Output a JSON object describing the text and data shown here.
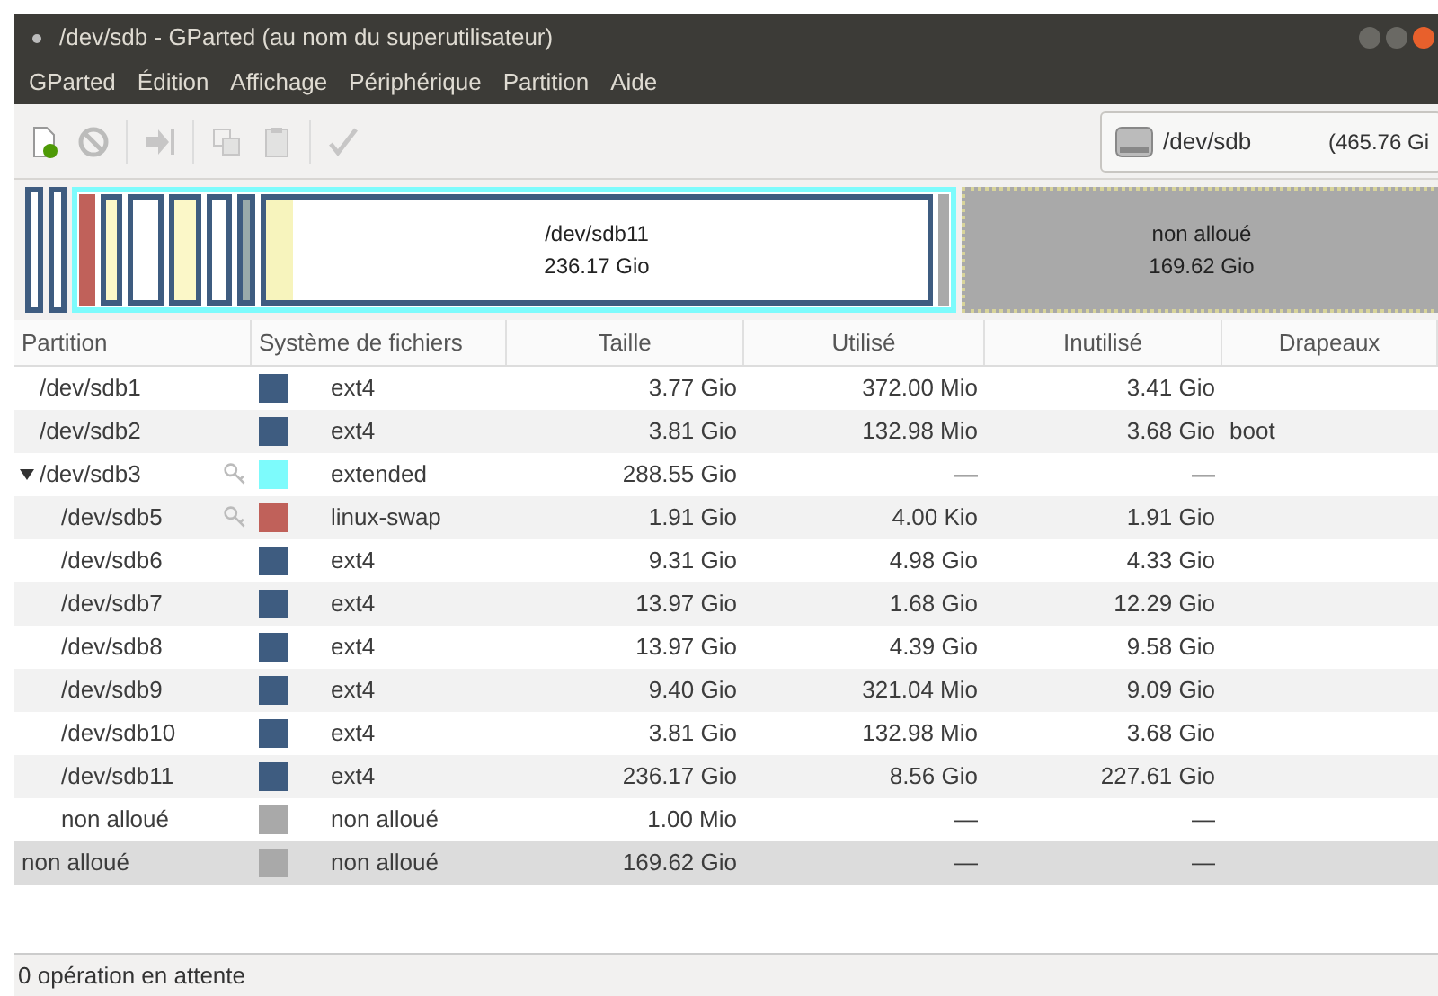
{
  "window": {
    "title": "/dev/sdb - GParted (au nom du superutilisateur)"
  },
  "menu": [
    "GParted",
    "Édition",
    "Affichage",
    "Périphérique",
    "Partition",
    "Aide"
  ],
  "toolbar": {
    "device": "/dev/sdb",
    "device_size": "(465.76 Gi"
  },
  "disk_map": {
    "main_partition": {
      "name": "/dev/sdb11",
      "size": "236.17 Gio",
      "level": 0.04
    },
    "unallocated": {
      "name": "non alloué",
      "size": "169.62 Gio"
    }
  },
  "table": {
    "columns": [
      "Partition",
      "Système de fichiers",
      "Taille",
      "Utilisé",
      "Inutilisé",
      "Drapeaux"
    ],
    "rows": [
      {
        "partition": "/dev/sdb1",
        "filesystem": "ext4",
        "color": "#3e5c80",
        "size": "3.77 Gio",
        "used": "372.00 Mio",
        "unused": "3.41 Gio",
        "selected": false
      },
      {
        "partition": "/dev/sdb2",
        "filesystem": "ext4",
        "color": "#3e5c80",
        "size": "3.81 Gio",
        "used": "132.98 Mio",
        "unused": "3.68 Gio",
        "flags": "boot",
        "selected": false
      },
      {
        "partition": "/dev/sdb3",
        "filesystem": "extended",
        "color": "#7dfbfc",
        "size": "288.55 Gio",
        "used": "—",
        "unused": "—",
        "expanded": true,
        "locked": true,
        "selected": false,
        "children": [
          {
            "partition": "/dev/sdb5",
            "filesystem": "linux-swap",
            "color": "#c0615a",
            "size": "1.91 Gio",
            "used": "4.00 Kio",
            "unused": "1.91 Gio",
            "locked": true,
            "selected": false
          },
          {
            "partition": "/dev/sdb6",
            "filesystem": "ext4",
            "color": "#3e5c80",
            "size": "9.31 Gio",
            "used": "4.98 Gio",
            "unused": "4.33 Gio",
            "selected": false
          },
          {
            "partition": "/dev/sdb7",
            "filesystem": "ext4",
            "color": "#3e5c80",
            "size": "13.97 Gio",
            "used": "1.68 Gio",
            "unused": "12.29 Gio",
            "selected": false
          },
          {
            "partition": "/dev/sdb8",
            "filesystem": "ext4",
            "color": "#3e5c80",
            "size": "13.97 Gio",
            "used": "4.39 Gio",
            "unused": "9.58 Gio",
            "selected": false
          },
          {
            "partition": "/dev/sdb9",
            "filesystem": "ext4",
            "color": "#3e5c80",
            "size": "9.40 Gio",
            "used": "321.04 Mio",
            "unused": "9.09 Gio",
            "selected": false
          },
          {
            "partition": "/dev/sdb10",
            "filesystem": "ext4",
            "color": "#3e5c80",
            "size": "3.81 Gio",
            "used": "132.98 Mio",
            "unused": "3.68 Gio",
            "selected": false
          },
          {
            "partition": "/dev/sdb11",
            "filesystem": "ext4",
            "color": "#3e5c80",
            "size": "236.17 Gio",
            "used": "8.56 Gio",
            "unused": "227.61 Gio",
            "selected": false
          },
          {
            "partition": "non alloué",
            "filesystem": "non alloué",
            "color": "#a9a9a9",
            "size": "1.00 Mio",
            "used": "—",
            "unused": "—",
            "selected": false
          }
        ]
      },
      {
        "partition": "non alloué",
        "filesystem": "non alloué",
        "color": "#a9a9a9",
        "size": "169.62 Gio",
        "used": "—",
        "unused": "—",
        "selected": true
      }
    ]
  },
  "status_bar": "0 opération en attente"
}
